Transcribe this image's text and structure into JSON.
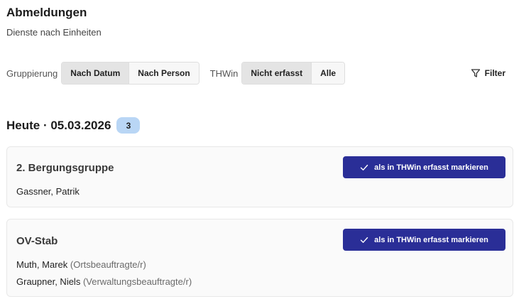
{
  "header": {
    "title": "Abmeldungen",
    "subtitle": "Dienste nach Einheiten"
  },
  "toolbar": {
    "grouping_label": "Gruppierung",
    "grouping_options": [
      "Nach Datum",
      "Nach Person"
    ],
    "grouping_selected": "Nach Datum",
    "thwin_label": "THWin",
    "thwin_options": [
      "Nicht erfasst",
      "Alle"
    ],
    "thwin_selected": "Nicht erfasst",
    "filter_label": "Filter",
    "filter_icon": "filter-funnel-icon"
  },
  "group": {
    "title": "Heute · 05.03.2026",
    "count": "3"
  },
  "units": [
    {
      "name": "2. Bergungsgruppe",
      "action_label": "als in THWin erfasst markieren",
      "members": [
        {
          "name": "Gassner, Patrik",
          "role": ""
        }
      ]
    },
    {
      "name": "OV-Stab",
      "action_label": "als in THWin erfasst markieren",
      "members": [
        {
          "name": "Muth, Marek",
          "role": "(Ortsbeauftragte/r)"
        },
        {
          "name": "Graupner, Niels",
          "role": "(Verwaltungsbeauftragte/r)"
        }
      ]
    }
  ],
  "colors": {
    "primary_button": "#2a2e97",
    "count_badge": "#b9d6f5",
    "active_segment": "#e4e4e4"
  }
}
